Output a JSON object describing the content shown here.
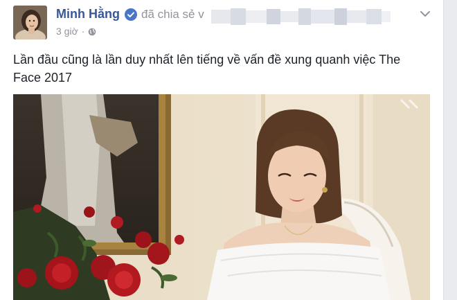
{
  "post": {
    "author_name": "Minh Hằng",
    "verified_icon": "verified-badge-icon",
    "shared_action": "đã chia sẻ v",
    "timestamp": "3 giờ",
    "separator": "·",
    "privacy_icon": "globe-icon",
    "options_icon": "chevron-down-icon",
    "text": "Lần đầu cũng là lần duy nhất lên tiếng về vấn đề xung quanh việc The Face 2017",
    "media_type": "video"
  },
  "colors": {
    "author_link": "#365899",
    "secondary_text": "#90949c",
    "body_text": "#1d2129",
    "page_background": "#e9ebee"
  }
}
